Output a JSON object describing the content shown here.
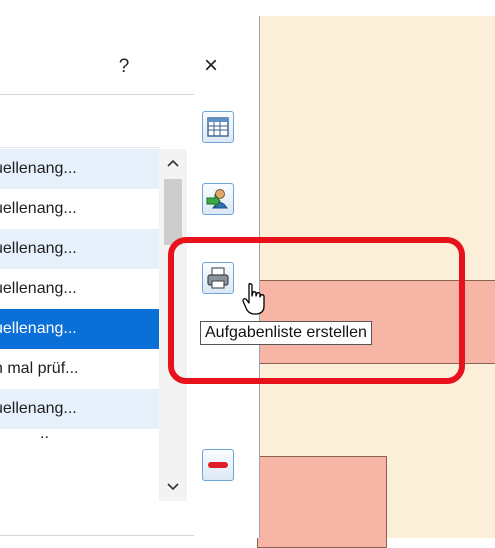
{
  "dialog": {
    "help_label": "?",
    "close_label": "×"
  },
  "list": {
    "rows": [
      {
        "text": "uellenang...",
        "style": "alt"
      },
      {
        "text": "uellenang...",
        "style": "plain"
      },
      {
        "text": "uellenang...",
        "style": "alt"
      },
      {
        "text": "uellenang...",
        "style": "plain"
      },
      {
        "text": "uellenang...",
        "style": "selected"
      },
      {
        "text": "n mal prüf...",
        "style": "plain"
      },
      {
        "text": "uellenang...",
        "style": "alt"
      },
      {
        "text": "..",
        "style": "plain"
      }
    ]
  },
  "scrollbar": {
    "up_arrow": "^",
    "down_arrow": "v"
  },
  "toolbar": {
    "buttons": [
      {
        "name": "table-icon"
      },
      {
        "name": "user-export-icon"
      },
      {
        "name": "print-icon"
      },
      {
        "name": "remove-icon"
      }
    ]
  },
  "tooltip": {
    "text": "Aufgabenliste erstellen"
  },
  "colors": {
    "selection": "#0a6fd6",
    "row_alt": "#e6f1fb",
    "highlight": "#e8121c",
    "doc_bg": "#fcefd9",
    "doc_shape": "#f6b5a5"
  }
}
